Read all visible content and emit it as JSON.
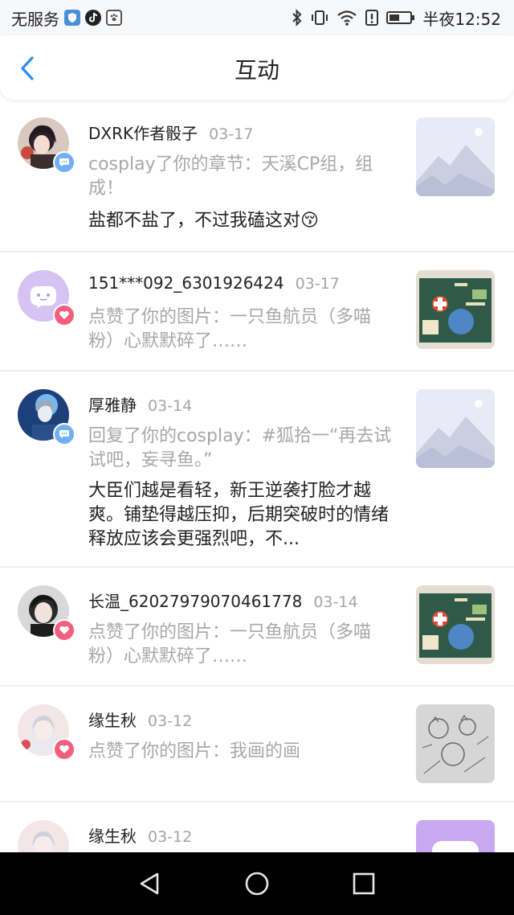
{
  "status_bar": {
    "carrier": "无服务",
    "time_label": "半夜12:52"
  },
  "header": {
    "title": "互动"
  },
  "items": [
    {
      "name": "DXRK作者骰子",
      "date": "03-17",
      "badge": "comment",
      "action": "cosplay了你的章节：天溪CP组，组成！",
      "content": "盐都不盐了，不过我磕这对😚",
      "thumb": "placeholder"
    },
    {
      "name": "151***092_6301926424",
      "date": "03-17",
      "badge": "like",
      "action": "点赞了你的图片：一只鱼航员（多喵粉）心默默碎了……",
      "content": "",
      "thumb": "chalkboard"
    },
    {
      "name": "厚雅静",
      "date": "03-14",
      "badge": "comment",
      "action": "回复了你的cosplay：#狐拾一“再去试试吧，妄寻鱼。”",
      "content": "大臣们越是看轻，新王逆袭打脸才越爽。铺垫得越压抑，后期突破时的情绪释放应该会更强烈吧，不...",
      "thumb": "placeholder"
    },
    {
      "name": "长温_62027979070461778",
      "date": "03-14",
      "badge": "like",
      "action": "点赞了你的图片：一只鱼航员（多喵粉）心默默碎了……",
      "content": "",
      "thumb": "chalkboard"
    },
    {
      "name": "缘生秋",
      "date": "03-12",
      "badge": "like",
      "action": "点赞了你的图片：我画的画",
      "content": "",
      "thumb": "sketch"
    },
    {
      "name": "缘生秋",
      "date": "03-12",
      "badge": "like",
      "action": "",
      "content": "",
      "thumb": "purple"
    }
  ],
  "colors": {
    "accent": "#2f8ef0",
    "like": "#f25f7e",
    "comment": "#6fb0f2"
  }
}
